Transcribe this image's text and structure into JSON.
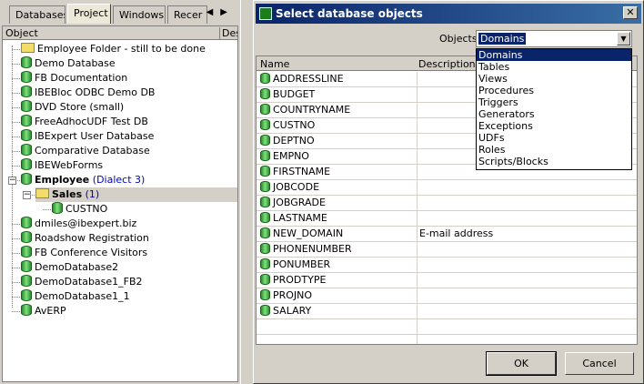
{
  "left_tabs": [
    "Databases",
    "Project",
    "Windows",
    "Recer"
  ],
  "tree_header": {
    "col1": "Object",
    "col2": "Des"
  },
  "tree_items": [
    "Employee Folder - still to be done",
    "Demo Database",
    "FB Documentation",
    "IBEBloc ODBC Demo DB",
    "DVD Store (small)",
    "FreeAdhocUDF Test DB",
    "IBExpert User Database",
    "Comparative Database",
    "IBEWebForms",
    "Employee",
    "Sales",
    "CUSTNO",
    "dmiles@ibexpert.biz",
    "Roadshow Registration",
    "FB Conference Visitors",
    "DemoDatabase2",
    "DemoDatabase1_FB2",
    "DemoDatabase1_1",
    "AvERP"
  ],
  "tree_extra": {
    "employee_dialect": "(Dialect 3)",
    "sales_count": "(1)"
  },
  "dialog": {
    "title": "Select database objects",
    "close": "✕",
    "objects_label": "Objects",
    "objects_value": "Domains",
    "dropdown_options": [
      "Domains",
      "Tables",
      "Views",
      "Procedures",
      "Triggers",
      "Generators",
      "Exceptions",
      "UDFs",
      "Roles",
      "Scripts/Blocks"
    ],
    "grid_headers": {
      "name": "Name",
      "description": "Description"
    },
    "rows": [
      {
        "name": "ADDRESSLINE",
        "desc": ""
      },
      {
        "name": "BUDGET",
        "desc": ""
      },
      {
        "name": "COUNTRYNAME",
        "desc": ""
      },
      {
        "name": "CUSTNO",
        "desc": ""
      },
      {
        "name": "DEPTNO",
        "desc": ""
      },
      {
        "name": "EMPNO",
        "desc": ""
      },
      {
        "name": "FIRSTNAME",
        "desc": ""
      },
      {
        "name": "JOBCODE",
        "desc": ""
      },
      {
        "name": "JOBGRADE",
        "desc": ""
      },
      {
        "name": "LASTNAME",
        "desc": ""
      },
      {
        "name": "NEW_DOMAIN",
        "desc": "E-mail address"
      },
      {
        "name": "PHONENUMBER",
        "desc": ""
      },
      {
        "name": "PONUMBER",
        "desc": ""
      },
      {
        "name": "PRODTYPE",
        "desc": ""
      },
      {
        "name": "PROJNO",
        "desc": ""
      },
      {
        "name": "SALARY",
        "desc": ""
      }
    ],
    "ok": "OK",
    "cancel": "Cancel"
  }
}
